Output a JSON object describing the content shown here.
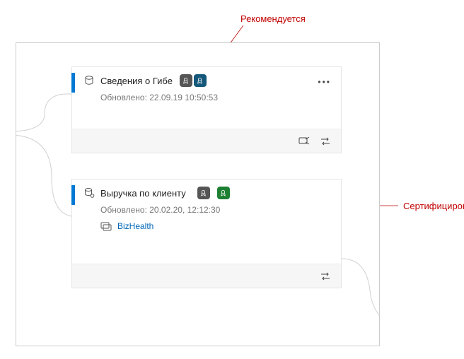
{
  "annotations": {
    "recommended": "Рекомендуется",
    "certified": "Сертифициров"
  },
  "cards": [
    {
      "title": "Сведения о Гибе",
      "updated": "Обновлено: 22.09.19 10:50:53",
      "badges": [
        "recommended-dark",
        "recommended-blue"
      ],
      "footer_icons": [
        "share",
        "swap"
      ]
    },
    {
      "title": "Выручка по клиенту",
      "updated": "Обновлено: 20.02.20, 12:12:30",
      "badges": [
        "cert-dark",
        "cert-green"
      ],
      "folder": "BizHealth",
      "footer_icons": [
        "swap"
      ]
    }
  ]
}
